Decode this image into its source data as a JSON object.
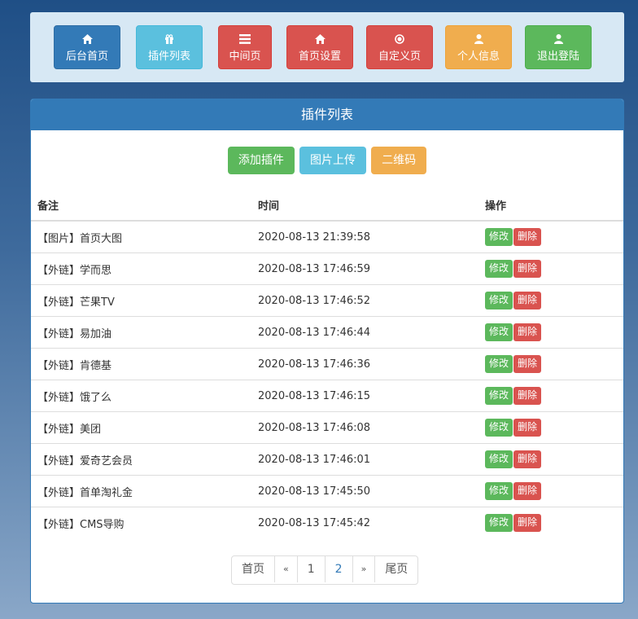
{
  "nav": [
    {
      "label": "后台首页",
      "icon": "home-icon",
      "color": "primary"
    },
    {
      "label": "插件列表",
      "icon": "gift-icon",
      "color": "info"
    },
    {
      "label": "中间页",
      "icon": "list-icon",
      "color": "danger"
    },
    {
      "label": "首页设置",
      "icon": "home-icon",
      "color": "danger"
    },
    {
      "label": "自定义页",
      "icon": "record-icon",
      "color": "danger"
    },
    {
      "label": "个人信息",
      "icon": "user-icon",
      "color": "warning"
    },
    {
      "label": "退出登陆",
      "icon": "user-icon",
      "color": "success"
    }
  ],
  "panel": {
    "title": "插件列表",
    "actions": {
      "add": "添加插件",
      "upload": "图片上传",
      "qrcode": "二维码"
    }
  },
  "table": {
    "headers": {
      "note": "备注",
      "time": "时间",
      "ops": "操作"
    },
    "edit_label": "修改",
    "delete_label": "删除",
    "rows": [
      {
        "note": "【图片】首页大图",
        "time": "2020-08-13 21:39:58"
      },
      {
        "note": "【外链】学而思",
        "time": "2020-08-13 17:46:59"
      },
      {
        "note": "【外链】芒果TV",
        "time": "2020-08-13 17:46:52"
      },
      {
        "note": "【外链】易加油",
        "time": "2020-08-13 17:46:44"
      },
      {
        "note": "【外链】肯德基",
        "time": "2020-08-13 17:46:36"
      },
      {
        "note": "【外链】饿了么",
        "time": "2020-08-13 17:46:15"
      },
      {
        "note": "【外链】美团",
        "time": "2020-08-13 17:46:08"
      },
      {
        "note": "【外链】爱奇艺会员",
        "time": "2020-08-13 17:46:01"
      },
      {
        "note": "【外链】首单淘礼金",
        "time": "2020-08-13 17:45:50"
      },
      {
        "note": "【外链】CMS导购",
        "time": "2020-08-13 17:45:42"
      }
    ]
  },
  "pagination": {
    "first": "首页",
    "prev": "«",
    "pages": [
      "1",
      "2"
    ],
    "next": "»",
    "last": "尾页"
  },
  "colors": {
    "primary": "#337ab7",
    "info": "#5bc0de",
    "danger": "#d9534f",
    "warning": "#f0ad4e",
    "success": "#5cb85c"
  }
}
